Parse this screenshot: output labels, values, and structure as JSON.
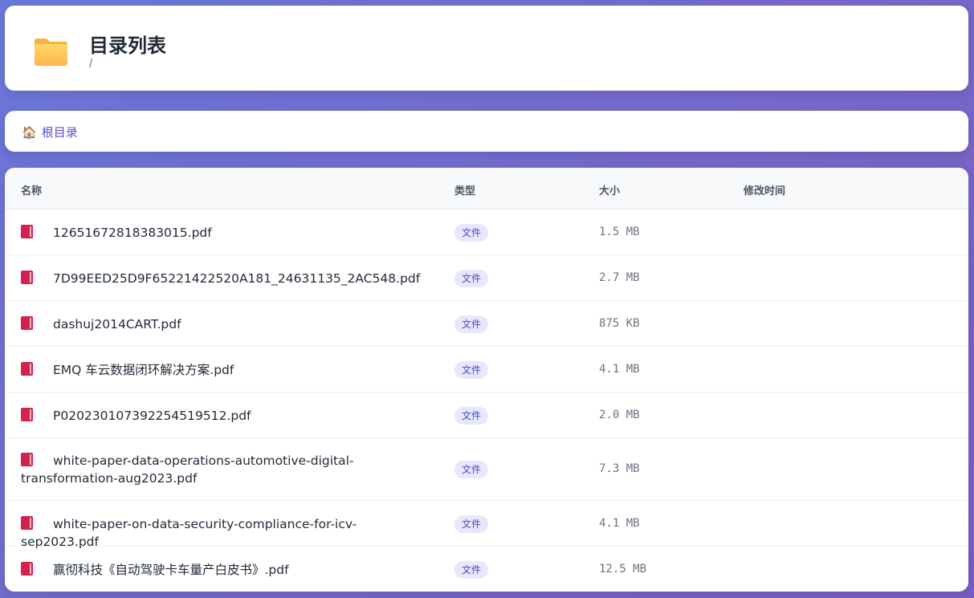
{
  "header": {
    "title": "目录列表",
    "path": "/",
    "icon": "folder-icon"
  },
  "breadcrumb": {
    "home_icon": "🏠",
    "home_label": "根目录"
  },
  "table": {
    "columns": [
      "名称",
      "类型",
      "大小",
      "修改时间"
    ],
    "rows": [
      {
        "name": "12651672818383015.pdf",
        "type": "文件",
        "size": "1.5 MB",
        "mtime": ""
      },
      {
        "name": "7D99EED25D9F65221422520A181_24631135_2AC548.pdf",
        "type": "文件",
        "size": "2.7 MB",
        "mtime": ""
      },
      {
        "name": "dashuj2014CART.pdf",
        "type": "文件",
        "size": "875 KB",
        "mtime": ""
      },
      {
        "name": "EMQ 车云数据闭环解决方案.pdf",
        "type": "文件",
        "size": "4.1 MB",
        "mtime": ""
      },
      {
        "name": "P020230107392254519512.pdf",
        "type": "文件",
        "size": "2.0 MB",
        "mtime": ""
      },
      {
        "name": "white-paper-data-operations-automotive-digital-transformation-aug2023.pdf",
        "type": "文件",
        "size": "7.3 MB",
        "mtime": ""
      },
      {
        "name": "white-paper-on-data-security-compliance-for-icv-sep2023.pdf",
        "type": "文件",
        "size": "4.1 MB",
        "mtime": ""
      },
      {
        "name": "赢彻科技《自动驾驶卡车量产白皮书》.pdf",
        "type": "文件",
        "size": "12.5 MB",
        "mtime": ""
      }
    ]
  },
  "colors": {
    "accent": "#5b50c9",
    "badge_bg": "#e6e8fb",
    "file_icon": "#d3224e"
  }
}
